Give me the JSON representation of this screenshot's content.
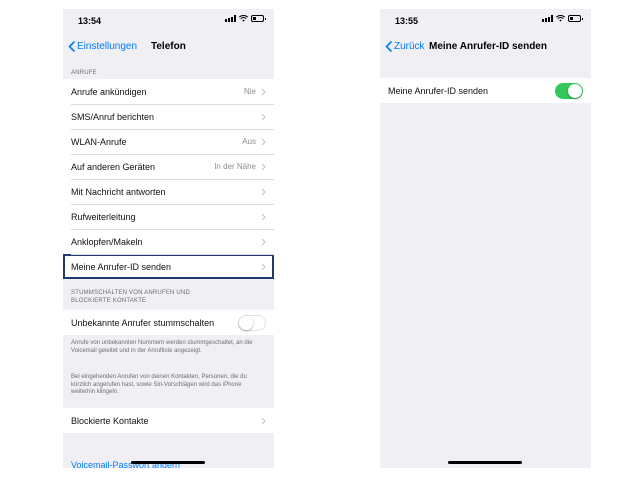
{
  "left": {
    "time": "13:54",
    "back_label": "Einstellungen",
    "title": "Telefon",
    "section_calls": "ANRUFE",
    "calls_rows": [
      {
        "label": "Anrufe ankündigen",
        "value": "Nie"
      },
      {
        "label": "SMS/Anruf berichten",
        "value": ""
      },
      {
        "label": "WLAN-Anrufe",
        "value": "Aus"
      },
      {
        "label": "Auf anderen Geräten",
        "value": "In der Nähe"
      },
      {
        "label": "Mit Nachricht antworten",
        "value": ""
      },
      {
        "label": "Rufweiterleitung",
        "value": ""
      },
      {
        "label": "Anklopfen/Makeln",
        "value": ""
      },
      {
        "label": "Meine Anrufer-ID senden",
        "value": ""
      }
    ],
    "section_mute_line1": "STUMMSCHALTEN VON ANRUFEN UND",
    "section_mute_line2": "BLOCKIERTE KONTAKTE",
    "mute_row_label": "Unbekannte Anrufer stummschalten",
    "mute_toggle_on": false,
    "footer1": "Anrufe von unbekannten Nummern werden stummgeschaltet, an die Voicemail geleitet und in der Anrufliste angezeigt.",
    "footer2": "Bei eingehenden Anrufen von deinen Kontakten, Personen, die du kürzlich angerufen hast, sowie Siri-Vorschlägen wird das iPhone weiterhin klingeln.",
    "blocked_label": "Blockierte Kontakte",
    "voicemail_label": "Voicemail-Passwort ändern"
  },
  "right": {
    "time": "13:55",
    "back_label": "Zurück",
    "title": "Meine Anrufer-ID senden",
    "row_label": "Meine Anrufer-ID senden",
    "toggle_on": true
  },
  "colors": {
    "accent": "#007aff",
    "toggle_on": "#34c759",
    "highlight_border": "#1f3a6b",
    "background": "#efeff4"
  },
  "icons": [
    "chevron-left-icon",
    "chevron-right-icon",
    "signal-icon",
    "wifi-icon",
    "battery-icon"
  ]
}
